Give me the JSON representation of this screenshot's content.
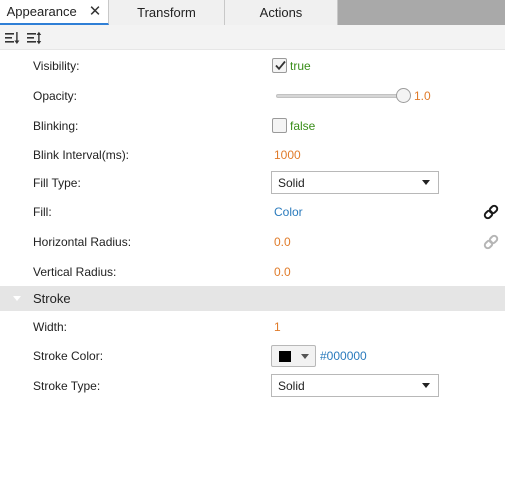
{
  "tabs": [
    {
      "label": "Appearance",
      "close": "✕"
    },
    {
      "label": "Transform"
    },
    {
      "label": "Actions"
    }
  ],
  "toolbar": {
    "icons": [
      "sort-descending-icon",
      "sort-custom-icon"
    ]
  },
  "properties": {
    "visibility": {
      "label": "Visibility:",
      "value": "true",
      "checked": true
    },
    "opacity": {
      "label": "Opacity:",
      "value": "1.0",
      "fraction": 1.0
    },
    "blinking": {
      "label": "Blinking:",
      "value": "false",
      "checked": false
    },
    "blink_interval": {
      "label": "Blink Interval(ms):",
      "value": "1000"
    },
    "fill_type": {
      "label": "Fill Type:",
      "value": "Solid"
    },
    "fill": {
      "label": "Fill:",
      "value": "Color"
    },
    "horizontal_radius": {
      "label": "Horizontal Radius:",
      "value": "0.0"
    },
    "vertical_radius": {
      "label": "Vertical Radius:",
      "value": "0.0"
    }
  },
  "stroke_section": {
    "title": "Stroke",
    "width": {
      "label": "Width:",
      "value": "1"
    },
    "stroke_color": {
      "label": "Stroke Color:",
      "value": "#000000",
      "swatch": "#000000"
    },
    "stroke_type": {
      "label": "Stroke Type:",
      "value": "Solid"
    }
  },
  "colors": {
    "accent_tab_underline": "#2f7fd6",
    "numeric_value": "#e07b2a",
    "link_value": "#2b7bbd",
    "boolean_value": "#3a8e1a",
    "section_header_bg": "#e5e5e5"
  }
}
